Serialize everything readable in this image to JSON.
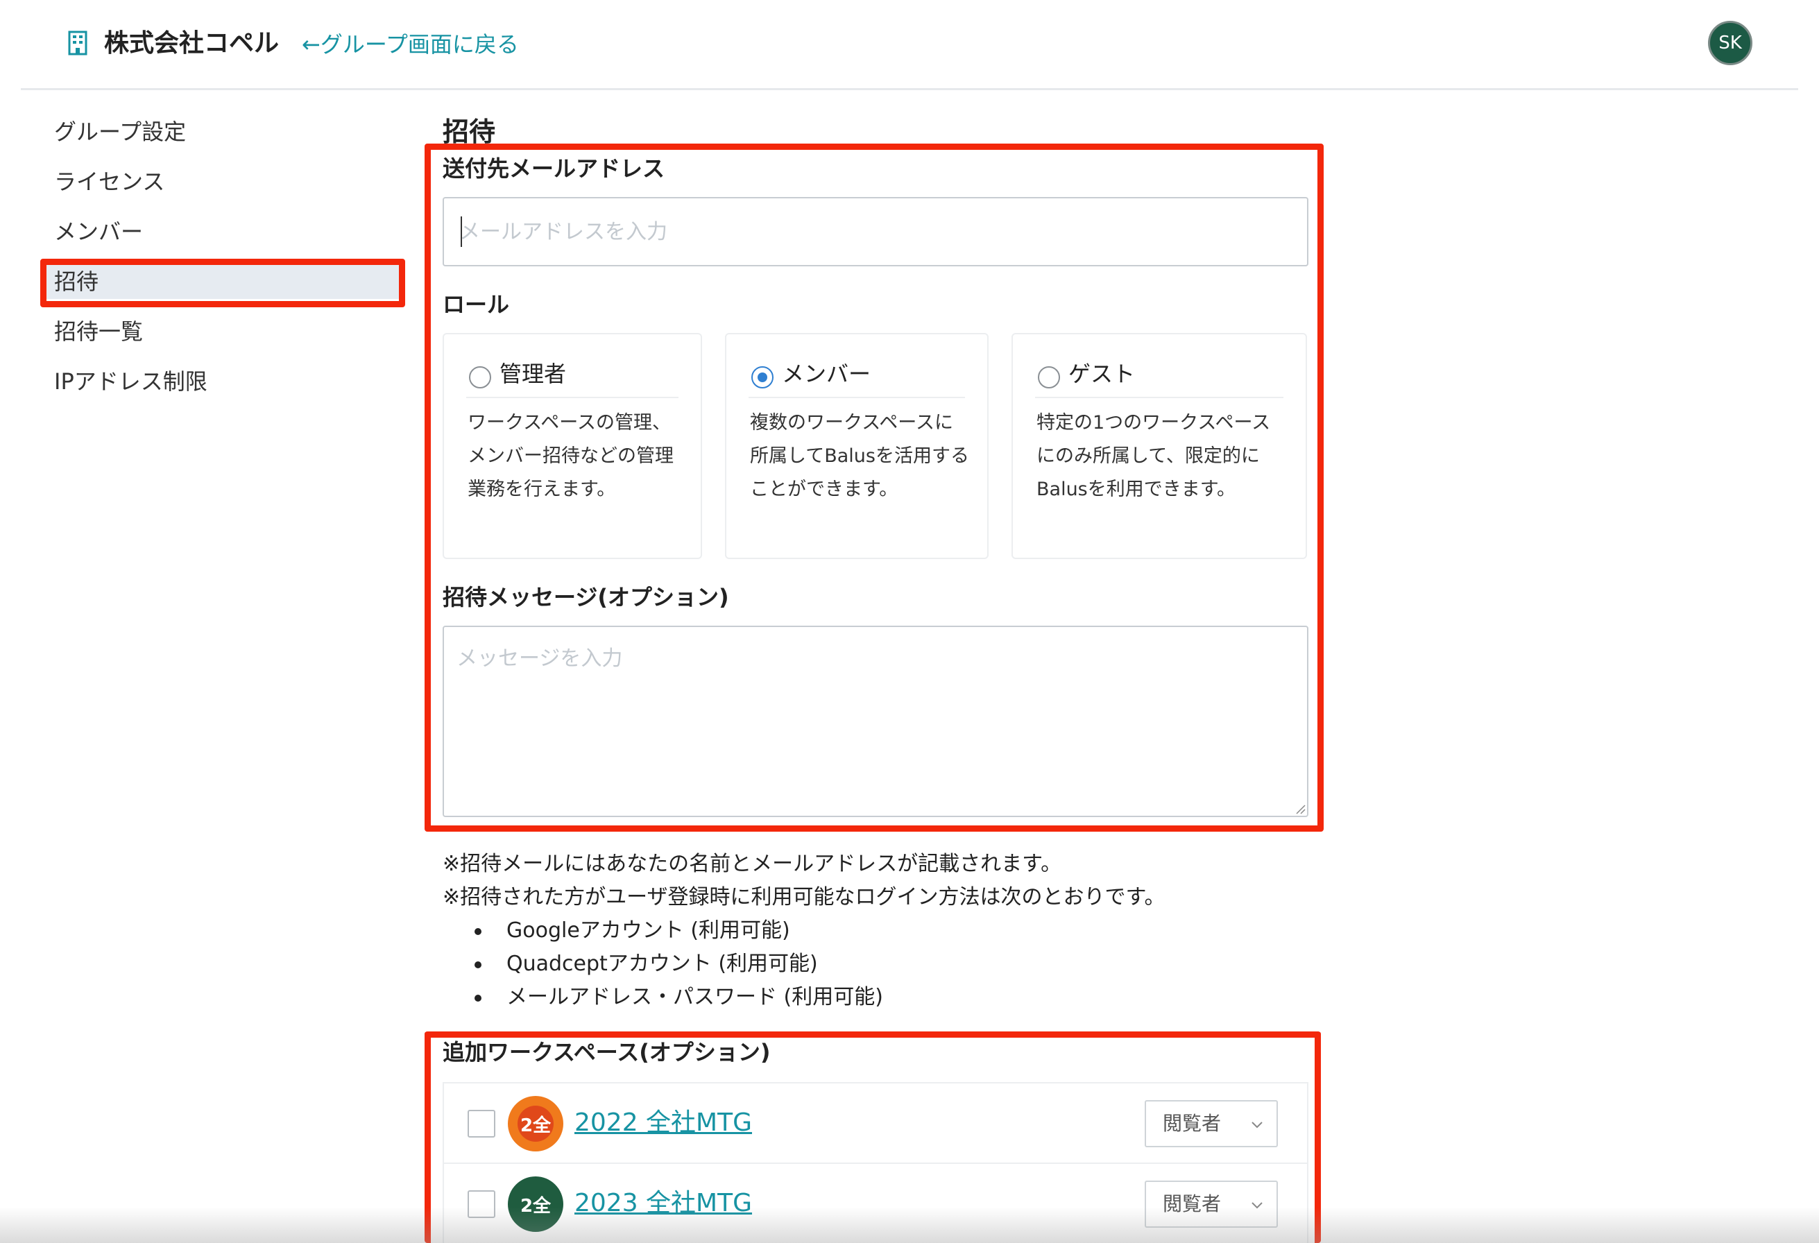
{
  "header": {
    "org_name": "株式会社コペル",
    "back_link": "←グループ画面に戻る",
    "avatar_initials": "SK",
    "icon": "building-icon"
  },
  "sidebar": {
    "items": [
      {
        "label": "グループ設定"
      },
      {
        "label": "ライセンス"
      },
      {
        "label": "メンバー"
      },
      {
        "label": "招待",
        "active": true
      },
      {
        "label": "招待一覧"
      },
      {
        "label": "IPアドレス制限"
      }
    ]
  },
  "main": {
    "title": "招待",
    "email": {
      "label": "送付先メールアドレス",
      "placeholder": "メールアドレスを入力",
      "value": ""
    },
    "role": {
      "label": "ロール",
      "options": [
        {
          "name": "管理者",
          "desc": "ワークスペースの管理、メンバー招待などの管理業務を行えます。",
          "selected": false
        },
        {
          "name": "メンバー",
          "desc": "複数のワークスペースに所属してBalusを活用することができます。",
          "selected": true
        },
        {
          "name": "ゲスト",
          "desc": "特定の1つのワークスペースにのみ所属して、限定的にBalusを利用できます。",
          "selected": false
        }
      ]
    },
    "message": {
      "label": "招待メッセージ(オプション)",
      "placeholder": "メッセージを入力"
    },
    "notes": {
      "line1": "※招待メールにはあなたの名前とメールアドレスが記載されます。",
      "line2": "※招待された方がユーザ登録時に利用可能なログイン方法は次のとおりです。",
      "methods": [
        "Googleアカウント (利用可能)",
        "Quadceptアカウント (利用可能)",
        "メールアドレス・パスワード (利用可能)"
      ]
    },
    "workspaces": {
      "label": "追加ワークスペース(オプション)",
      "items": [
        {
          "badge": "2全",
          "badge_color": "#e0481a",
          "name": "2022 全社MTG",
          "role": "閲覧者"
        },
        {
          "badge": "2全",
          "badge_color": "#1f5c3f",
          "name": "2023 全社MTG",
          "role": "閲覧者"
        }
      ]
    }
  },
  "colors": {
    "accent": "#1793a3",
    "highlight": "#f3270b",
    "radio_selected": "#2f7fd1"
  }
}
